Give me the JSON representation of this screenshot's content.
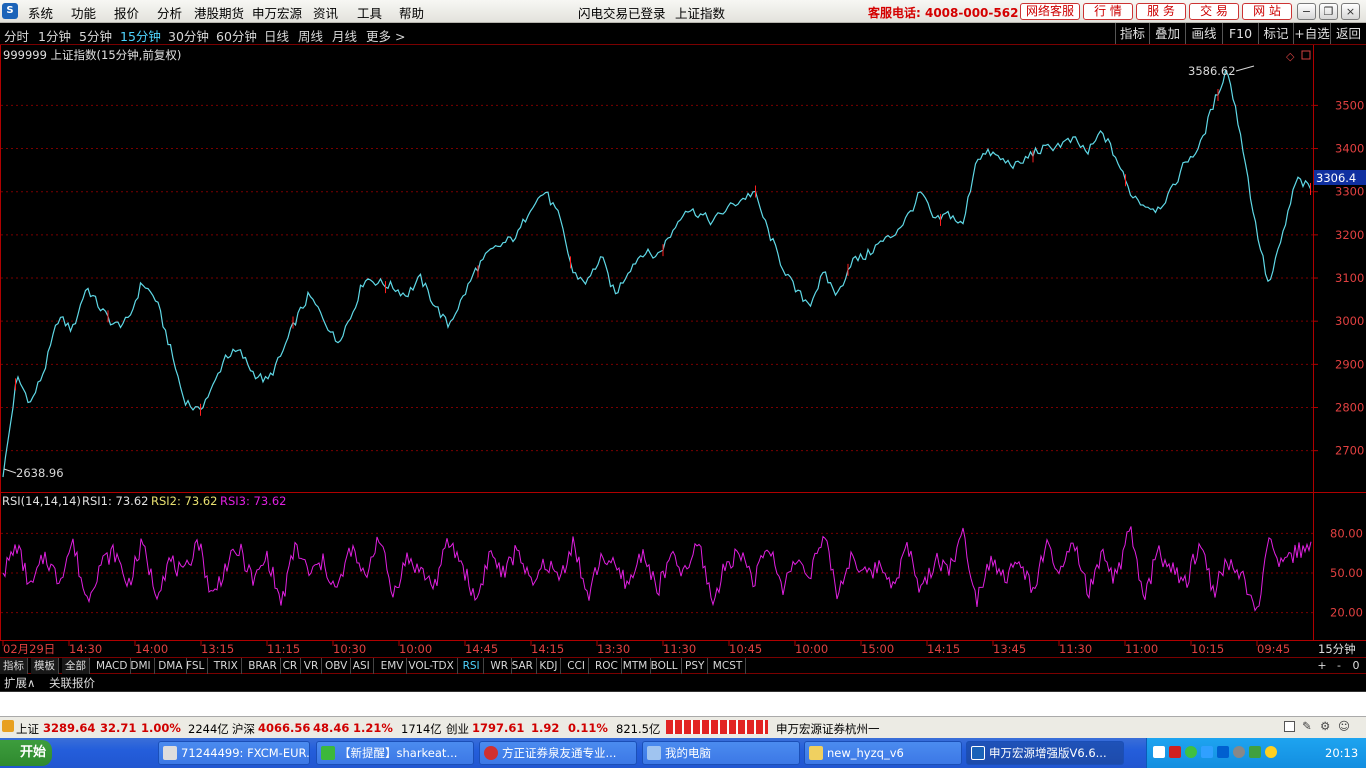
{
  "menu": {
    "items": [
      "系统",
      "功能",
      "报价",
      "分析",
      "港股期货",
      "申万宏源",
      "资讯",
      "工具",
      "帮助"
    ],
    "login_status": "闪电交易已登录",
    "index_name": "上证指数",
    "hotline": "客服电话: 4008-000-562",
    "red_buttons": [
      "网络客服",
      "行 情",
      "服 务",
      "交 易",
      "网 站"
    ]
  },
  "toolbar": {
    "timeframes": [
      "分时",
      "1分钟",
      "5分钟",
      "15分钟",
      "30分钟",
      "60分钟",
      "日线",
      "周线",
      "月线",
      "更多 >"
    ],
    "active": "15分钟",
    "right_buttons": [
      "指标",
      "叠加",
      "画线",
      "F10",
      "标记",
      "+自选",
      "返回"
    ]
  },
  "main_chart": {
    "title": "999999 上证指数(15分钟,前复权)",
    "max_label": "3586.62",
    "min_label": "2638.96",
    "price_ticks": [
      "3500",
      "3400",
      "3300",
      "3200",
      "3100",
      "3000",
      "2900",
      "2800",
      "2700"
    ],
    "current_price": "3306.4"
  },
  "rsi_panel": {
    "name": "RSI(14,14,14)",
    "rsi1": "RSI1: 73.62",
    "rsi2": "RSI2: 73.62",
    "rsi3": "RSI3: 73.62",
    "ticks": [
      "80.00",
      "50.00",
      "20.00"
    ]
  },
  "time_axis": {
    "labels": [
      "02月29日",
      "14:30",
      "14:00",
      "13:15",
      "11:15",
      "10:30",
      "10:00",
      "14:45",
      "14:15",
      "13:30",
      "11:30",
      "10:45",
      "10:00",
      "15:00",
      "14:15",
      "13:45",
      "11:30",
      "11:00",
      "10:15",
      "09:45"
    ],
    "period": "15分钟"
  },
  "indicator_tabs": {
    "head": [
      "指标",
      "模板",
      "全部"
    ],
    "items": [
      "MACD",
      "DMI",
      "DMA",
      "FSL",
      "TRIX",
      "BRAR",
      "CR",
      "VR",
      "OBV",
      "ASI",
      "EMV",
      "VOL-TDX",
      "RSI",
      "WR",
      "SAR",
      "KDJ",
      "CCI",
      "ROC",
      "MTM",
      "BOLL",
      "PSY",
      "MCST"
    ],
    "selected": "RSI",
    "controls": [
      "+",
      "-",
      "0"
    ]
  },
  "extension_bar": {
    "items": [
      "扩展∧",
      "关联报价"
    ]
  },
  "status_bar": {
    "sh_label": "上证",
    "sh_value": "3289.64",
    "sh_change": "32.71",
    "sh_pct": "1.00%",
    "sh_amount": "2244亿",
    "hs_label": "沪深",
    "hs_value": "4066.56",
    "hs_change": "48.46",
    "hs_pct": "1.21%",
    "hs_amount": "1714亿",
    "cy_label": "创业",
    "cy_value": "1797.61",
    "cy_change": "1.92",
    "cy_pct": "0.11%",
    "cy_amount": "821.5亿",
    "broker": "申万宏源证券杭州一"
  },
  "taskbar": {
    "start": "开始",
    "tasks": [
      "71244499: FXCM-EUR...",
      "【新提醒】sharkeat...",
      "方正证券泉友通专业...",
      "我的电脑",
      "new_hyzq_v6",
      "申万宏源增强版V6.6..."
    ],
    "clock": "20:13"
  },
  "colors": {
    "price_line": "#5fd8e6",
    "rsi_line": "#e020e0",
    "axis_red": "#b00000",
    "up_red": "#ff2020",
    "rsi2_yellow": "#e8e070"
  },
  "chart_data": [
    {
      "type": "line",
      "title": "999999 上证指数(15分钟,前复权)",
      "ylim": [
        2638.96,
        3586.62
      ],
      "y_ticks": [
        2700,
        2800,
        2900,
        3000,
        3100,
        3200,
        3300,
        3400,
        3500
      ],
      "x_labels": [
        "02月29日",
        "14:30",
        "14:00",
        "13:15",
        "11:15",
        "10:30",
        "10:00",
        "14:45",
        "14:15",
        "13:30",
        "11:30",
        "10:45",
        "10:00",
        "15:00",
        "14:15",
        "13:45",
        "11:30",
        "11:00",
        "10:15",
        "09:45"
      ],
      "series": [
        {
          "values": [
            2638.96,
            2870,
            2810,
            2890,
            3010,
            2980,
            3080,
            3030,
            2990,
            3000,
            3090,
            3050,
            2940,
            2820,
            2790,
            2840,
            2920,
            2930,
            2880,
            2860,
            2920,
            3000,
            3060,
            3010,
            2950,
            3010,
            3100,
            3090,
            3080,
            3060,
            3100,
            3040,
            2990,
            3050,
            3120,
            3160,
            3180,
            3200,
            3270,
            3300,
            3240,
            3110,
            3090,
            3150,
            3060,
            3120,
            3160,
            3150,
            3200,
            3260,
            3250,
            3230,
            3260,
            3280,
            3300,
            3210,
            3130,
            3070,
            3040,
            3110,
            3060,
            3140,
            3150,
            3180,
            3200,
            3240,
            3300,
            3230,
            3250,
            3220,
            3380,
            3390,
            3370,
            3360,
            3390,
            3400,
            3410,
            3420,
            3390,
            3440,
            3380,
            3300,
            3270,
            3260,
            3300,
            3370,
            3400,
            3500,
            3586.62,
            3430,
            3230,
            3080,
            3200,
            3330,
            3306.4
          ]
        }
      ]
    },
    {
      "type": "line",
      "title": "RSI(14,14,14)",
      "ylim": [
        0,
        100
      ],
      "y_ticks": [
        20,
        50,
        80
      ],
      "series": [
        {
          "name": "RSI3",
          "values": [
            50,
            71,
            38,
            64,
            44,
            74,
            29,
            57,
            66,
            41,
            72,
            35,
            60,
            47,
            77,
            31,
            55,
            68,
            43,
            63,
            26,
            71,
            49,
            58,
            36,
            69,
            45,
            80,
            33,
            61,
            52,
            40,
            74,
            57,
            28,
            66,
            48,
            70,
            38,
            59,
            45,
            75,
            30,
            64,
            53,
            41,
            68,
            36,
            62,
            49,
            73,
            27,
            58,
            66,
            44,
            71,
            39,
            60,
            51,
            77,
            33,
            65,
            47,
            56,
            42,
            70,
            35,
            61,
            54,
            79,
            31,
            63,
            46,
            58,
            38,
            69,
            50,
            72,
            34,
            62,
            45,
            83,
            29,
            67,
            52,
            41,
            74,
            36,
            59,
            48,
            18,
            71,
            55,
            66,
            73.62
          ]
        }
      ]
    }
  ]
}
